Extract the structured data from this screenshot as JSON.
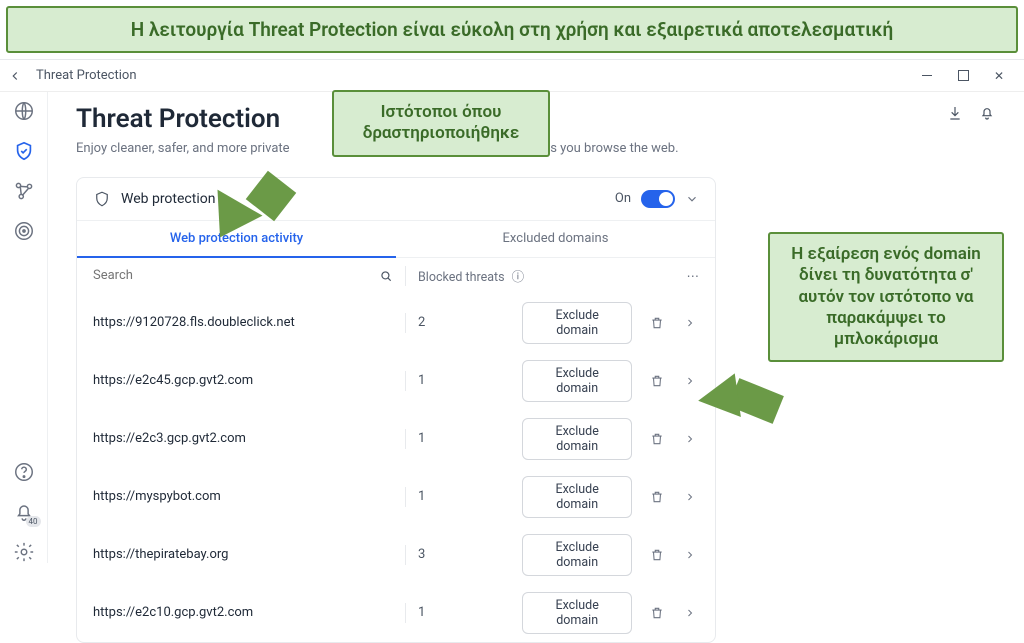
{
  "banner_text": "Η λειτουργία Threat Protection είναι εύκολη στη χρήση και εξαιρετικά αποτελεσματική",
  "titlebar": {
    "title": "Threat Protection"
  },
  "header": {
    "title": "Threat Protection",
    "subtitle_before": "Enjoy cleaner, safer, and more private",
    "subtitle_after": "in real time as you browse the web."
  },
  "panel": {
    "title": "Web protection",
    "toggle_state": "On"
  },
  "tabs": {
    "activity": "Web protection activity",
    "excluded": "Excluded domains"
  },
  "columns": {
    "search_placeholder": "Search",
    "blocked": "Blocked threats"
  },
  "actions": {
    "exclude": "Exclude domain"
  },
  "rows": [
    {
      "domain": "https://9120728.fls.doubleclick.net",
      "count": 2
    },
    {
      "domain": "https://e2c45.gcp.gvt2.com",
      "count": 1
    },
    {
      "domain": "https://e2c3.gcp.gvt2.com",
      "count": 1
    },
    {
      "domain": "https://myspybot.com",
      "count": 1
    },
    {
      "domain": "https://thepiratebay.org",
      "count": 3
    },
    {
      "domain": "https://e2c10.gcp.gvt2.com",
      "count": 1
    }
  ],
  "callouts": {
    "c1": "Ιστότοποι όπου δραστηριοποιήθηκε",
    "c2": "Η εξαίρεση ενός domain δίνει τη δυνατότητα σ' αυτόν τον ιστότοπο να παρακάμψει το μπλοκάρισμα"
  },
  "notif_badge": "40"
}
